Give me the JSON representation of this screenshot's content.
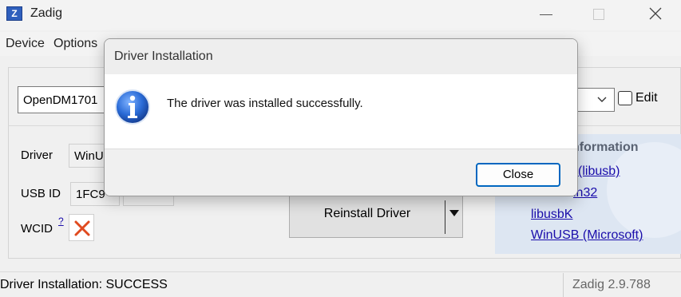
{
  "window": {
    "title": "Zadig",
    "app_icon_letter": "Z"
  },
  "menu": {
    "device": "Device",
    "options": "Options"
  },
  "device_select": {
    "value": "OpenDM1701"
  },
  "edit": {
    "label": "Edit",
    "checked": false
  },
  "driver_row": {
    "label": "Driver",
    "value": "WinU"
  },
  "usb_id_row": {
    "label": "USB ID",
    "value": "1FC9"
  },
  "wcid_row": {
    "label": "WCID",
    "help": "?",
    "status_icon": "x-icon"
  },
  "reinstall_button": {
    "label": "Reinstall Driver"
  },
  "info_panel": {
    "title": "nformation",
    "links": [
      "(libusb)",
      "in32",
      "libusbK",
      "WinUSB (Microsoft)"
    ]
  },
  "status": {
    "text": "Driver Installation: SUCCESS",
    "version": "Zadig 2.9.788"
  },
  "dialog": {
    "title": "Driver Installation",
    "message": "The driver was installed successfully.",
    "icon": "info-icon",
    "close_label": "Close"
  },
  "colors": {
    "accent": "#0067c0",
    "link": "#1a0dab",
    "info_icon": "#1f5fbf",
    "error_x": "#e04a1f"
  }
}
